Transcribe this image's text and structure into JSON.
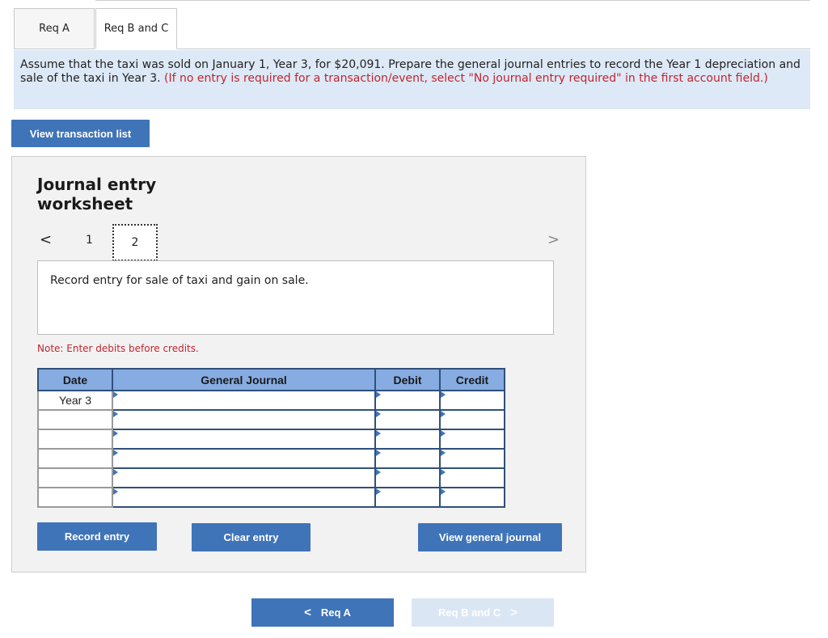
{
  "tabs": {
    "req_a": "Req A",
    "req_bc": "Req B and C"
  },
  "instructions": {
    "main": "Assume that the taxi was sold on January 1, Year 3, for $20,091. Prepare the general journal entries to record the Year 1 depreciation and sale of the taxi in Year 3.",
    "hint": "(If no entry is required for a transaction/event, select \"No journal entry required\" in the first account field.)"
  },
  "buttons": {
    "view_transaction_list": "View transaction list",
    "record_entry": "Record entry",
    "clear_entry": "Clear entry",
    "view_general_journal": "View general journal"
  },
  "worksheet": {
    "title": "Journal entry worksheet",
    "pager": {
      "prev": "<",
      "page1": "1",
      "page2": "2",
      "next": ">"
    },
    "prompt": "Record entry for sale of taxi and gain on sale.",
    "note": "Note: Enter debits before credits."
  },
  "journal": {
    "headers": {
      "date": "Date",
      "account": "General Journal",
      "debit": "Debit",
      "credit": "Credit"
    },
    "rows": [
      {
        "date": "Year 3",
        "account": "",
        "debit": "",
        "credit": ""
      },
      {
        "date": "",
        "account": "",
        "debit": "",
        "credit": ""
      },
      {
        "date": "",
        "account": "",
        "debit": "",
        "credit": ""
      },
      {
        "date": "",
        "account": "",
        "debit": "",
        "credit": ""
      },
      {
        "date": "",
        "account": "",
        "debit": "",
        "credit": ""
      },
      {
        "date": "",
        "account": "",
        "debit": "",
        "credit": ""
      }
    ]
  },
  "nav": {
    "prev_label": "Req A",
    "next_label": "Req B and C",
    "prev_chevron": "<",
    "next_chevron": ">"
  },
  "colors": {
    "accent": "#3f74b9",
    "header_fill": "#86ace2",
    "instructions_bg": "#dde9f6",
    "alert_red": "#c0262f"
  }
}
